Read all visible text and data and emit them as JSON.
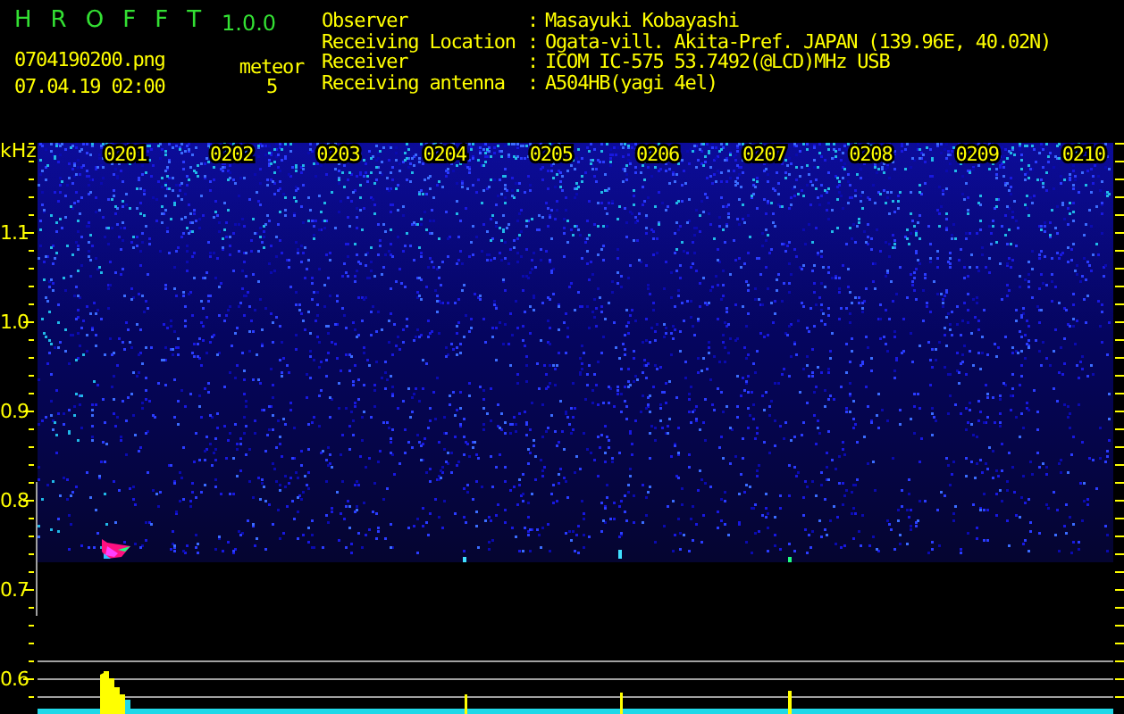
{
  "app": {
    "title": "H R O F F T",
    "version": "1.0.0"
  },
  "file": {
    "filename": "0704190200.png",
    "datetime": "07.04.19 02:00",
    "meteor_label": "meteor",
    "meteor_count": "5"
  },
  "info": [
    {
      "label": "Observer",
      "separator": ":",
      "value": "Masayuki Kobayashi"
    },
    {
      "label": "Receiving Location",
      "separator": ":",
      "value": "Ogata-vill. Akita-Pref. JAPAN (139.96E, 40.02N)"
    },
    {
      "label": "Receiver",
      "separator": ":",
      "value": "ICOM IC-575 53.7492(@LCD)MHz USB"
    },
    {
      "label": "Receiving antenna",
      "separator": ":",
      "value": "A504HB(yagi 4el)"
    }
  ],
  "plot": {
    "unit_label": "kHz",
    "y_labels": [
      "1.1",
      "1.0",
      "0.9",
      "0.8",
      "0.7",
      "0.6"
    ],
    "x_labels": [
      "0201",
      "0202",
      "0203",
      "0204",
      "0205",
      "0206",
      "0207",
      "0208",
      "0209",
      "0210"
    ]
  }
}
